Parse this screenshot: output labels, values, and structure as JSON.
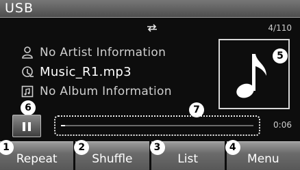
{
  "header": {
    "title": "USB"
  },
  "status": {
    "track_counter": "4/110",
    "elapsed_time": "0:06",
    "progress_fraction": 0.02
  },
  "track_info": {
    "artist": "No Artist Information",
    "file": "Music_R1.mp3",
    "album": "No Album Information"
  },
  "callouts": {
    "album_art": "5",
    "pause": "6",
    "progress": "7"
  },
  "bottom_buttons": [
    {
      "number": "1",
      "label": "Repeat"
    },
    {
      "number": "2",
      "label": "Shuffle"
    },
    {
      "number": "3",
      "label": "List"
    },
    {
      "number": "4",
      "label": "Menu"
    }
  ],
  "icons": {
    "repeat_mode": "repeat-arrows-icon",
    "artist": "person-icon",
    "file": "music-file-icon",
    "album": "album-icon",
    "album_art": "music-note-icon",
    "pause": "pause-icon"
  },
  "colors": {
    "background": "#0d0d0d",
    "titlebar": "#5e5e5e",
    "text": "#cfcfcf",
    "button": "#6b6b6b"
  }
}
